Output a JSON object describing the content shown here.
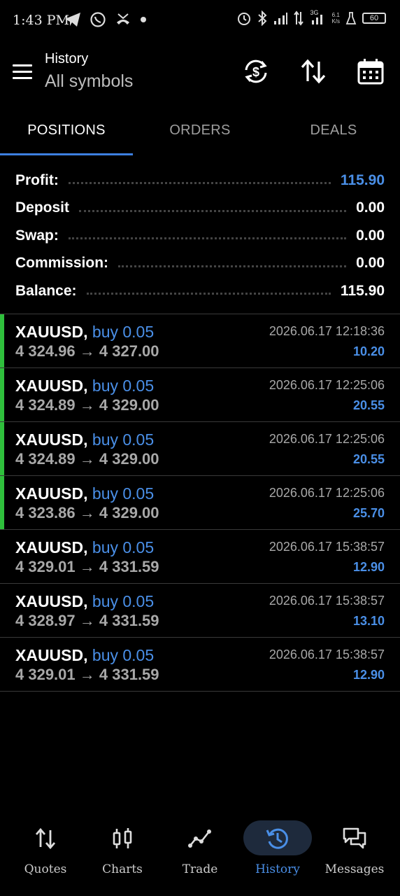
{
  "status_bar": {
    "time": "1:43 PM",
    "net_speed_value": "6.1",
    "net_speed_unit": "K/s",
    "network_label": "3G",
    "battery": "60"
  },
  "header": {
    "title": "History",
    "subtitle": "All symbols"
  },
  "tabs": [
    {
      "label": "POSITIONS",
      "active": true
    },
    {
      "label": "ORDERS",
      "active": false
    },
    {
      "label": "DEALS",
      "active": false
    }
  ],
  "summary": [
    {
      "label": "Profit:",
      "value": "115.90"
    },
    {
      "label": "Deposit",
      "value": "0.00"
    },
    {
      "label": "Swap:",
      "value": "0.00"
    },
    {
      "label": "Commission:",
      "value": "0.00"
    },
    {
      "label": "Balance:",
      "value": "115.90"
    }
  ],
  "positions": [
    {
      "symbol": "XAUUSD,",
      "side": "buy 0.05",
      "open_price": "4 324.96",
      "arrow": "→",
      "close_price": "4 327.00",
      "time": "2026.06.17 12:18:36",
      "profit": "10.20",
      "open_marker": true
    },
    {
      "symbol": "XAUUSD,",
      "side": "buy 0.05",
      "open_price": "4 324.89",
      "arrow": "→",
      "close_price": "4 329.00",
      "time": "2026.06.17 12:25:06",
      "profit": "20.55",
      "open_marker": true
    },
    {
      "symbol": "XAUUSD,",
      "side": "buy 0.05",
      "open_price": "4 324.89",
      "arrow": "→",
      "close_price": "4 329.00",
      "time": "2026.06.17 12:25:06",
      "profit": "20.55",
      "open_marker": true
    },
    {
      "symbol": "XAUUSD,",
      "side": "buy 0.05",
      "open_price": "4 323.86",
      "arrow": "→",
      "close_price": "4 329.00",
      "time": "2026.06.17 12:25:06",
      "profit": "25.70",
      "open_marker": true
    },
    {
      "symbol": "XAUUSD,",
      "side": "buy 0.05",
      "open_price": "4 329.01",
      "arrow": "→",
      "close_price": "4 331.59",
      "time": "2026.06.17 15:38:57",
      "profit": "12.90",
      "open_marker": false
    },
    {
      "symbol": "XAUUSD,",
      "side": "buy 0.05",
      "open_price": "4 328.97",
      "arrow": "→",
      "close_price": "4 331.59",
      "time": "2026.06.17 15:38:57",
      "profit": "13.10",
      "open_marker": false
    },
    {
      "symbol": "XAUUSD,",
      "side": "buy 0.05",
      "open_price": "4 329.01",
      "arrow": "→",
      "close_price": "4 331.59",
      "time": "2026.06.17 15:38:57",
      "profit": "12.90",
      "open_marker": false
    }
  ],
  "bottom_nav": [
    {
      "label": "Quotes",
      "icon": "quotes-icon"
    },
    {
      "label": "Charts",
      "icon": "charts-icon"
    },
    {
      "label": "Trade",
      "icon": "trade-icon"
    },
    {
      "label": "History",
      "icon": "history-icon",
      "active": true
    },
    {
      "label": "Messages",
      "icon": "messages-icon"
    }
  ],
  "colors": {
    "accent": "#4a8fe7",
    "open_marker": "#2fbf3c",
    "background": "#000000"
  }
}
